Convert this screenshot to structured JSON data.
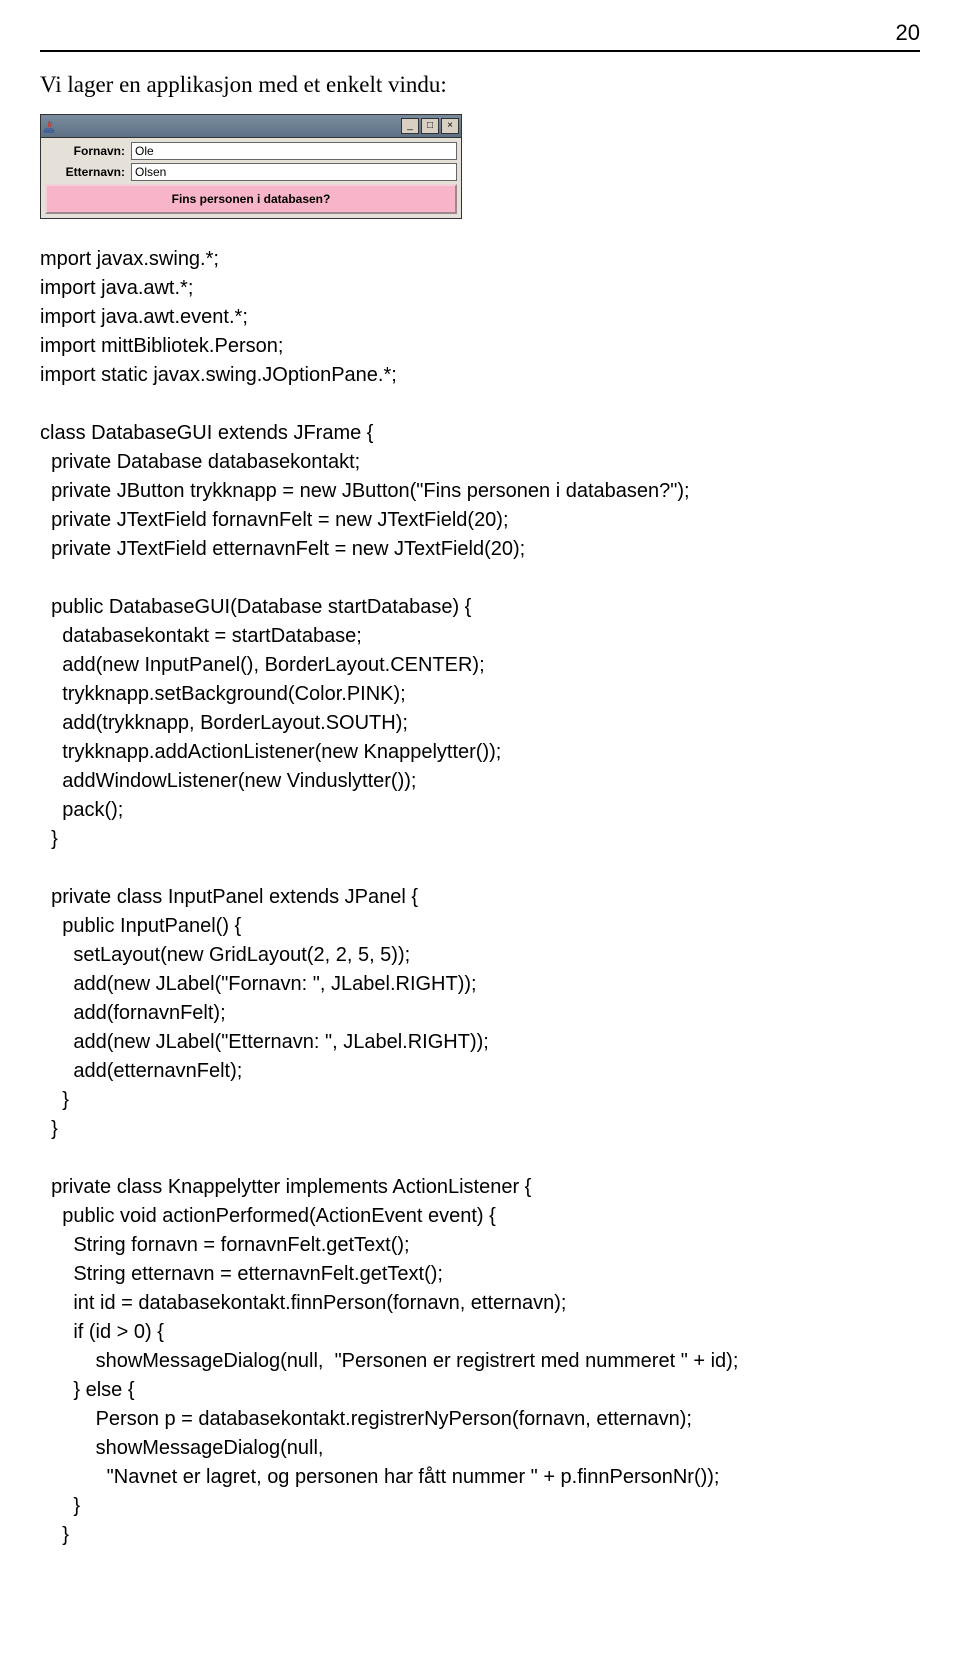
{
  "page_number": "20",
  "intro_text": "Vi lager en applikasjon med et enkelt vindu:",
  "swing": {
    "labels": {
      "fornavn": "Fornavn:",
      "etternavn": "Etternavn:"
    },
    "values": {
      "fornavn": "Ole",
      "etternavn": "Olsen"
    },
    "button_label": "Fins personen i databasen?",
    "win_controls": {
      "min": "_",
      "max": "□",
      "close": "×"
    }
  },
  "code": "mport javax.swing.*;\nimport java.awt.*;\nimport java.awt.event.*;\nimport mittBibliotek.Person;\nimport static javax.swing.JOptionPane.*;\n\nclass DatabaseGUI extends JFrame {\n  private Database databasekontakt;\n  private JButton trykknapp = new JButton(\"Fins personen i databasen?\");\n  private JTextField fornavnFelt = new JTextField(20);\n  private JTextField etternavnFelt = new JTextField(20);\n\n  public DatabaseGUI(Database startDatabase) {\n    databasekontakt = startDatabase;\n    add(new InputPanel(), BorderLayout.CENTER);\n    trykknapp.setBackground(Color.PINK);\n    add(trykknapp, BorderLayout.SOUTH);\n    trykknapp.addActionListener(new Knappelytter());\n    addWindowListener(new Vinduslytter());\n    pack();\n  }\n\n  private class InputPanel extends JPanel {\n    public InputPanel() {\n      setLayout(new GridLayout(2, 2, 5, 5));\n      add(new JLabel(\"Fornavn: \", JLabel.RIGHT));\n      add(fornavnFelt);\n      add(new JLabel(\"Etternavn: \", JLabel.RIGHT));\n      add(etternavnFelt);\n    }\n  }\n\n  private class Knappelytter implements ActionListener {\n    public void actionPerformed(ActionEvent event) {\n      String fornavn = fornavnFelt.getText();\n      String etternavn = etternavnFelt.getText();\n      int id = databasekontakt.finnPerson(fornavn, etternavn);\n      if (id > 0) {\n          showMessageDialog(null,  \"Personen er registrert med nummeret \" + id);\n      } else {\n          Person p = databasekontakt.registrerNyPerson(fornavn, etternavn);\n          showMessageDialog(null,\n            \"Navnet er lagret, og personen har fått nummer \" + p.finnPersonNr());\n      }\n    }"
}
